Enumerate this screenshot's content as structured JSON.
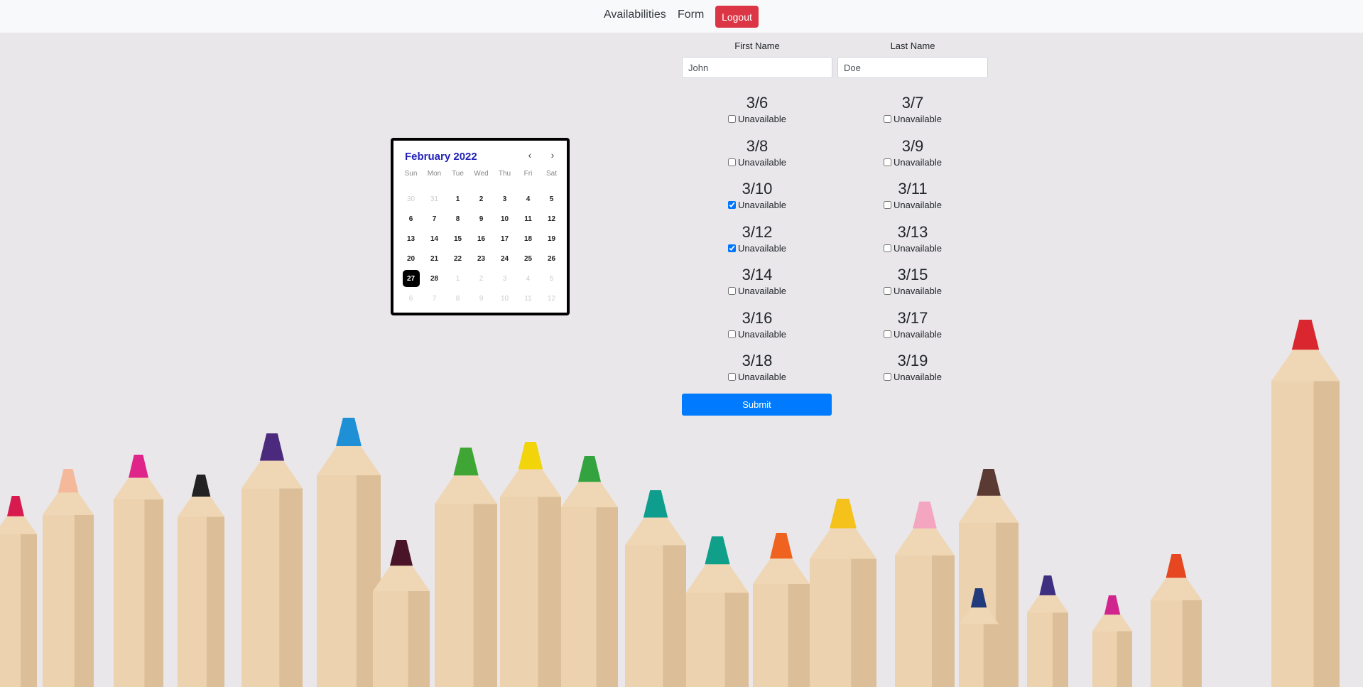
{
  "nav": {
    "links": [
      {
        "label": "Availabilities"
      },
      {
        "label": "Form"
      }
    ],
    "logout_label": "Logout",
    "logout_color": "#dc3545"
  },
  "form": {
    "first_name_label": "First Name",
    "last_name_label": "Last Name",
    "first_name_value": "John",
    "last_name_value": "Doe",
    "submit_label": "Submit",
    "submit_color": "#007bff",
    "dates": [
      {
        "date": "3/6",
        "label": "Unavailable",
        "checked": false
      },
      {
        "date": "3/7",
        "label": "Unavailable",
        "checked": false
      },
      {
        "date": "3/8",
        "label": "Unavailable",
        "checked": false
      },
      {
        "date": "3/9",
        "label": "Unavailable",
        "checked": false
      },
      {
        "date": "3/10",
        "label": "Unavailable",
        "checked": true
      },
      {
        "date": "3/11",
        "label": "Unavailable",
        "checked": false
      },
      {
        "date": "3/12",
        "label": "Unavailable",
        "checked": true
      },
      {
        "date": "3/13",
        "label": "Unavailable",
        "checked": false
      },
      {
        "date": "3/14",
        "label": "Unavailable",
        "checked": false
      },
      {
        "date": "3/15",
        "label": "Unavailable",
        "checked": false
      },
      {
        "date": "3/16",
        "label": "Unavailable",
        "checked": false
      },
      {
        "date": "3/17",
        "label": "Unavailable",
        "checked": false
      },
      {
        "date": "3/18",
        "label": "Unavailable",
        "checked": false
      },
      {
        "date": "3/19",
        "label": "Unavailable",
        "checked": false
      }
    ]
  },
  "calendar": {
    "month_label": "February 2022",
    "prev_icon": "chevron-left-icon",
    "next_icon": "chevron-right-icon",
    "weekdays": [
      "Sun",
      "Mon",
      "Tue",
      "Wed",
      "Thu",
      "Fri",
      "Sat"
    ],
    "weeks": [
      [
        {
          "d": "30",
          "m": true
        },
        {
          "d": "31",
          "m": true
        },
        {
          "d": "1"
        },
        {
          "d": "2"
        },
        {
          "d": "3"
        },
        {
          "d": "4"
        },
        {
          "d": "5"
        }
      ],
      [
        {
          "d": "6"
        },
        {
          "d": "7"
        },
        {
          "d": "8"
        },
        {
          "d": "9"
        },
        {
          "d": "10"
        },
        {
          "d": "11"
        },
        {
          "d": "12"
        }
      ],
      [
        {
          "d": "13"
        },
        {
          "d": "14"
        },
        {
          "d": "15"
        },
        {
          "d": "16"
        },
        {
          "d": "17"
        },
        {
          "d": "18"
        },
        {
          "d": "19"
        }
      ],
      [
        {
          "d": "20"
        },
        {
          "d": "21"
        },
        {
          "d": "22"
        },
        {
          "d": "23"
        },
        {
          "d": "24"
        },
        {
          "d": "25"
        },
        {
          "d": "26"
        }
      ],
      [
        {
          "d": "27",
          "s": true
        },
        {
          "d": "28"
        },
        {
          "d": "1",
          "m": true
        },
        {
          "d": "2",
          "m": true
        },
        {
          "d": "3",
          "m": true
        },
        {
          "d": "4",
          "m": true
        },
        {
          "d": "5",
          "m": true
        }
      ],
      [
        {
          "d": "6",
          "m": true
        },
        {
          "d": "7",
          "m": true
        },
        {
          "d": "8",
          "m": true
        },
        {
          "d": "9",
          "m": true
        },
        {
          "d": "10",
          "m": true
        },
        {
          "d": "11",
          "m": true
        },
        {
          "d": "12",
          "m": true
        }
      ]
    ],
    "selected_day": "27",
    "header_color": "#2222bb"
  },
  "background": {
    "description_icon": "colored-pencils-background"
  }
}
